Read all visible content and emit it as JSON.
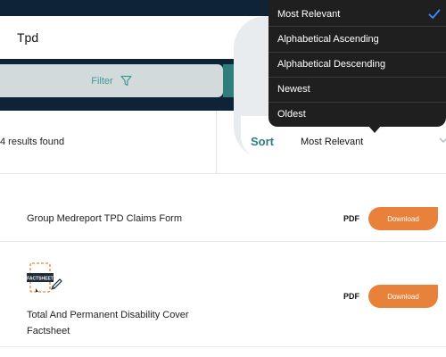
{
  "search": {
    "value": "Tpd"
  },
  "filter": {
    "label": "Filter",
    "icon": "filter-icon"
  },
  "results": {
    "count_text": "4 results found"
  },
  "sort": {
    "label": "Sort",
    "selected": "Most Relevant",
    "options": [
      {
        "label": "Most Relevant",
        "checked": true
      },
      {
        "label": "Alphabetical Ascending"
      },
      {
        "label": "Alphabetical Descending"
      },
      {
        "label": "Newest"
      },
      {
        "label": "Oldest"
      }
    ]
  },
  "documents": [
    {
      "title": "Group Medreport TPD Claims Form",
      "type": "PDF",
      "action": "Download"
    },
    {
      "title_line1": "Total And Permanent Disability Cover",
      "title_line2": "Factsheet",
      "type": "PDF",
      "action": "Download",
      "icon": "factsheet-icon",
      "icon_text": "FACTSHEET"
    }
  ],
  "colors": {
    "header_bg": "#0e2436",
    "accent_teal": "#2f7d7c",
    "download_orange": "#e8823a",
    "dropdown_bg": "#1f1f1f",
    "check_blue": "#3a8cff"
  }
}
